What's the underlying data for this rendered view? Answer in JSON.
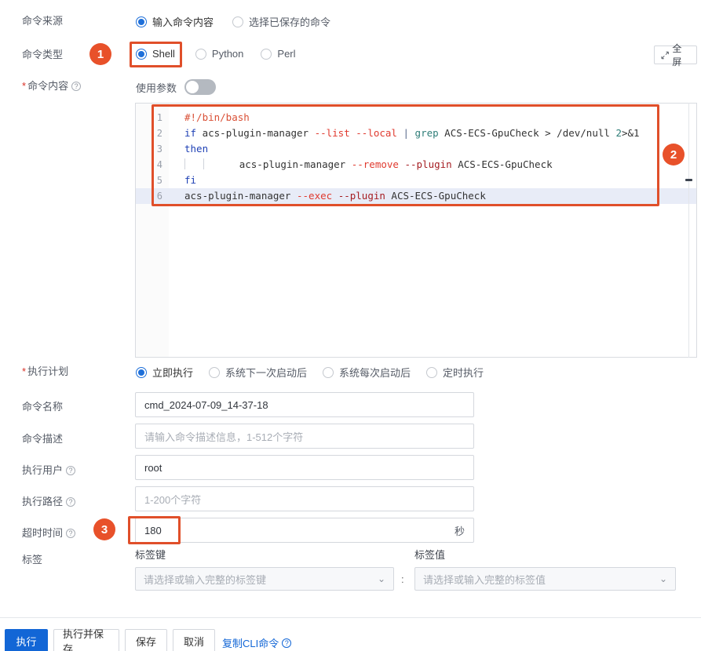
{
  "form": {
    "command_source": {
      "label": "命令来源",
      "options": [
        "输入命令内容",
        "选择已保存的命令"
      ],
      "selected": "输入命令内容"
    },
    "command_type": {
      "label": "命令类型",
      "options": [
        "Shell",
        "Python",
        "Perl"
      ],
      "selected": "Shell"
    },
    "command_content": {
      "label": "命令内容",
      "required": true,
      "use_params_label": "使用参数",
      "use_params_on": false,
      "fullscreen_label": "全屏"
    },
    "execution_plan": {
      "label": "执行计划",
      "required": true,
      "options": [
        "立即执行",
        "系统下一次启动后",
        "系统每次启动后",
        "定时执行"
      ],
      "selected": "立即执行"
    },
    "command_name": {
      "label": "命令名称",
      "value": "cmd_2024-07-09_14-37-18",
      "placeholder": ""
    },
    "command_desc": {
      "label": "命令描述",
      "value": "",
      "placeholder": "请输入命令描述信息，1-512个字符"
    },
    "exec_user": {
      "label": "执行用户",
      "value": "root",
      "placeholder": ""
    },
    "exec_path": {
      "label": "执行路径",
      "value": "",
      "placeholder": "1-200个字符"
    },
    "timeout": {
      "label": "超时时间",
      "value": "180",
      "suffix": "秒"
    },
    "tags": {
      "label": "标签",
      "key_label": "标签键",
      "value_label": "标签值",
      "key_placeholder": "请选择或输入完整的标签键",
      "value_placeholder": "请选择或输入完整的标签值",
      "separator": ":"
    }
  },
  "editor": {
    "lines": [
      {
        "num": "1",
        "tokens": [
          {
            "t": "#!/bin/bash",
            "c": "tok-cmt"
          }
        ]
      },
      {
        "num": "2",
        "tokens": [
          {
            "t": "if",
            "c": "tok-kw"
          },
          {
            "t": " acs-plugin-manager ",
            "c": "tok-pln"
          },
          {
            "t": "--list",
            "c": "tok-flag"
          },
          {
            "t": " ",
            "c": "tok-pln"
          },
          {
            "t": "--local",
            "c": "tok-flag"
          },
          {
            "t": " ",
            "c": "tok-pln"
          },
          {
            "t": "|",
            "c": "tok-pipe"
          },
          {
            "t": " ",
            "c": "tok-pln"
          },
          {
            "t": "grep",
            "c": "tok-fn"
          },
          {
            "t": " ACS-ECS-GpuCheck > /dev/null ",
            "c": "tok-pln"
          },
          {
            "t": "2",
            "c": "tok-num"
          },
          {
            "t": ">&1",
            "c": "tok-pln"
          }
        ]
      },
      {
        "num": "3",
        "tokens": [
          {
            "t": "then",
            "c": "tok-kw"
          }
        ]
      },
      {
        "num": "4",
        "indent_guides": 2,
        "tokens": [
          {
            "t": "   acs-plugin-manager ",
            "c": "tok-pln"
          },
          {
            "t": "--remove",
            "c": "tok-flag"
          },
          {
            "t": " ",
            "c": "tok-pln"
          },
          {
            "t": "--plugin",
            "c": "tok-flag2"
          },
          {
            "t": " ACS-ECS-GpuCheck",
            "c": "tok-pln"
          }
        ]
      },
      {
        "num": "5",
        "tokens": [
          {
            "t": "fi",
            "c": "tok-kw"
          }
        ]
      },
      {
        "num": "6",
        "active": true,
        "tokens": [
          {
            "t": "acs-plugin-manager ",
            "c": "tok-pln"
          },
          {
            "t": "--exec",
            "c": "tok-flag"
          },
          {
            "t": " ",
            "c": "tok-pln"
          },
          {
            "t": "--plugin",
            "c": "tok-flag2"
          },
          {
            "t": " ACS-ECS-GpuCheck",
            "c": "tok-pln"
          }
        ]
      }
    ],
    "plain_text": "#!/bin/bash\nif acs-plugin-manager --list --local | grep ACS-ECS-GpuCheck > /dev/null 2>&1\nthen\n    acs-plugin-manager --remove --plugin ACS-ECS-GpuCheck\nfi\nacs-plugin-manager --exec --plugin ACS-ECS-GpuCheck"
  },
  "annotations": {
    "badge1": "1",
    "badge2": "2",
    "badge3": "3",
    "color": "#e8512a"
  },
  "footer": {
    "run": "执行",
    "run_and_save": "执行并保存",
    "save": "保存",
    "cancel": "取消",
    "copy_cli": "复制CLI命令"
  },
  "colors": {
    "accent": "#1266d6",
    "highlight": "#e04f2a",
    "required": "#d93026"
  }
}
